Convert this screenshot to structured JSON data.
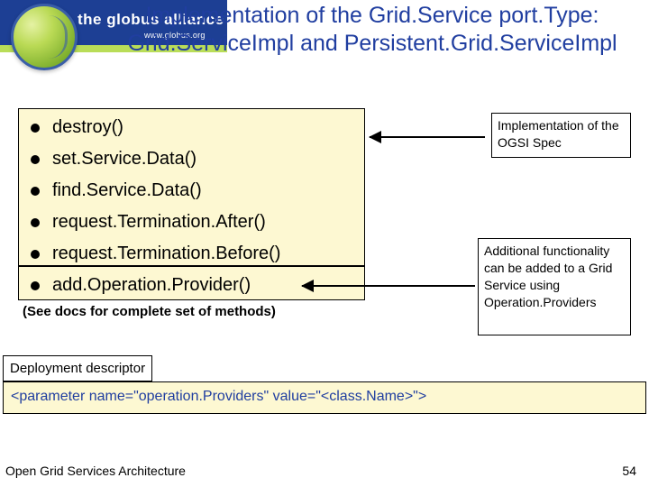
{
  "logo": {
    "brand": "the globus alliance",
    "url": "www.globus.org"
  },
  "title": "Implementation of the Grid.Service port.Type: Grid.ServiceImpl and Persistent.Grid.ServiceImpl",
  "bullets": [
    "destroy()",
    "set.Service.Data()",
    "find.Service.Data()",
    "request.Termination.After()",
    "request.Termination.Before()",
    "add.Operation.Provider()"
  ],
  "subnote": "(See docs for complete set of methods)",
  "callout1": "Implementation of the OGSI Spec",
  "callout2": "Additional functionality can be added to a Grid Service using Operation.Providers",
  "deployment_label": "Deployment descriptor",
  "parameter_line": "<parameter name=\"operation.Providers\" value=\"<class.Name>\">",
  "footer": "Open Grid Services Architecture",
  "page": "54"
}
